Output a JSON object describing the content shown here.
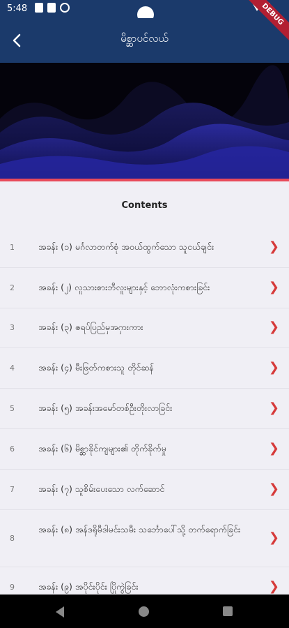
{
  "status_bar": {
    "time": "5:48"
  },
  "debug_banner": "DEBUG",
  "app_bar": {
    "title": "မိစ္ဆာပင်လယ်",
    "back_icon": "chevron-left-icon"
  },
  "colors": {
    "app_bar": "#1b3a6b",
    "accent_line": "#e84a5a",
    "chevron": "#d63a3a"
  },
  "contents": {
    "title": "Contents",
    "items": [
      {
        "num": "1",
        "label": "အခန်း (၁) မင်္ဂလာတက်စုံ အဝယ်ထွက်သော သူငယ်ချင်း"
      },
      {
        "num": "2",
        "label": "အခန်း (၂) လူသားစားဘီလူးများနှင့် ဘောလုံးကစားခြင်း"
      },
      {
        "num": "3",
        "label": "အခန်း (၃) ဇရပ်ပြည်မှအဂှားကား"
      },
      {
        "num": "4",
        "label": "အခန်း (၄) မီးဖြတ်ကစားသူ တိုင်ဆန်"
      },
      {
        "num": "5",
        "label": "အခန်း (၅) အခန်းအမော်တစ်ဦးတိုးလာခြင်း"
      },
      {
        "num": "6",
        "label": "အခန်း (၆) မိစ္ဆာခိုင်ကျများ၏ တိုက်ခိုက်မှု"
      },
      {
        "num": "7",
        "label": "အခန်း (၇) သူစိမ်းပေးသော လက်ဆောင်"
      },
      {
        "num": "8",
        "label": "အခန်း (၈) အန်ဒရိုမီဒါမင်းသမီး သင်္ဘောပေါ်သို့ တက်ရောက်ခြင်း"
      },
      {
        "num": "9",
        "label": "အခန်း (၉) အပိုင်းပိုင်း ပြိုကွဲခြင်း"
      }
    ]
  },
  "nav_bar": {
    "back": "nav-back-icon",
    "home": "nav-home-icon",
    "recent": "nav-recents-icon"
  }
}
